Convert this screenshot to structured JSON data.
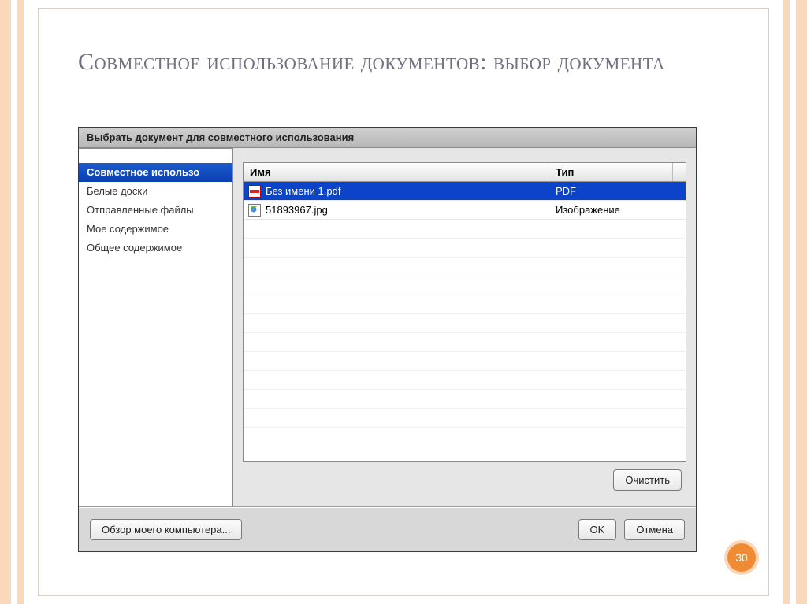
{
  "slide": {
    "title": "Совместное использование документов: выбор документа",
    "number": "30"
  },
  "dialog": {
    "title": "Выбрать документ для совместного использования",
    "sidebar": {
      "items": [
        {
          "label": "Совместное использо",
          "selected": true
        },
        {
          "label": "Белые доски",
          "selected": false
        },
        {
          "label": "Отправленные файлы",
          "selected": false
        },
        {
          "label": "Мое содержимое",
          "selected": false
        },
        {
          "label": "Общее содержимое",
          "selected": false
        }
      ]
    },
    "table": {
      "columns": {
        "name": "Имя",
        "type": "Тип"
      },
      "rows": [
        {
          "icon": "pdf",
          "name": "Без имени 1.pdf",
          "type": "PDF",
          "selected": true
        },
        {
          "icon": "img",
          "name": "51893967.jpg",
          "type": "Изображение",
          "selected": false
        }
      ]
    },
    "buttons": {
      "clear": "Очистить",
      "browse": "Обзор моего компьютера...",
      "ok": "OK",
      "cancel": "Отмена"
    }
  }
}
